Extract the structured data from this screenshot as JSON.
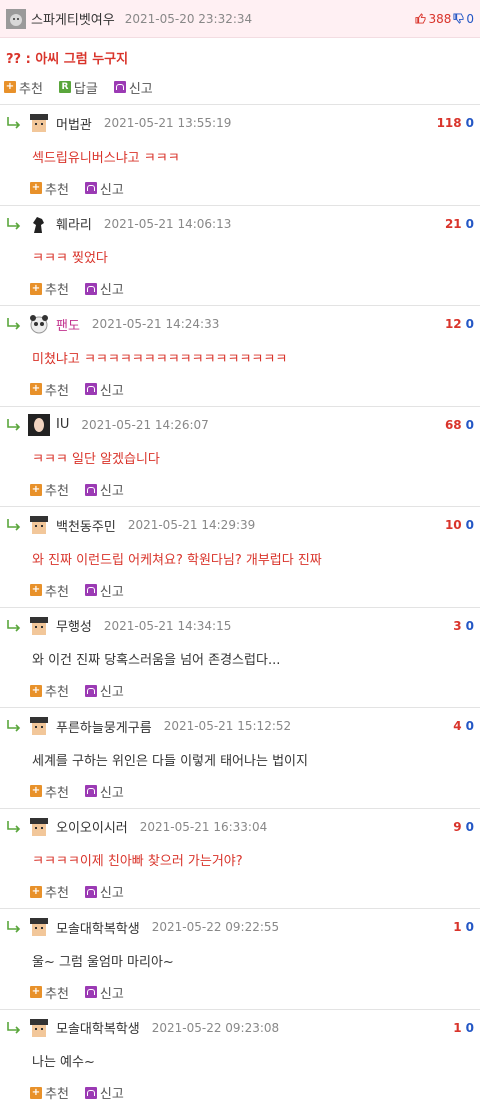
{
  "post": {
    "nick": "스파게티벳여우",
    "date": "2021-05-20 23:32:34",
    "up": "388",
    "down": "0",
    "content": "?? : 아씨 그럼 누구지",
    "recommend_label": "추천",
    "reply_label": "답글",
    "report_label": "신고"
  },
  "comments": [
    {
      "nick": "머법관",
      "date": "2021-05-21 13:55:19",
      "up": "118",
      "down": "0",
      "text": "섹드립유니버스냐고 ㅋㅋㅋ",
      "recommend": "추천",
      "report": "신고"
    },
    {
      "nick": "훼라리",
      "date": "2021-05-21 14:06:13",
      "up": "21",
      "down": "0",
      "text": "ㅋㅋㅋ 찢었다",
      "recommend": "추천",
      "report": "신고"
    },
    {
      "nick": "팬도",
      "date": "2021-05-21 14:24:33",
      "up": "12",
      "down": "0",
      "text": "미쳤냐고 ㅋㅋㅋㅋㅋㅋㅋㅋㅋㅋㅋㅋㅋㅋㅋㅋㅋ",
      "recommend": "추천",
      "report": "신고"
    },
    {
      "nick": "IU",
      "date": "2021-05-21 14:26:07",
      "up": "68",
      "down": "0",
      "text": "ㅋㅋㅋ 일단 알겠습니다",
      "recommend": "추천",
      "report": "신고"
    },
    {
      "nick": "백천동주민",
      "date": "2021-05-21 14:29:39",
      "up": "10",
      "down": "0",
      "text": "와 진짜 이런드립 어케쳐요? 학원다님? 개부럽다 진짜",
      "recommend": "추천",
      "report": "신고"
    },
    {
      "nick": "무행성",
      "date": "2021-05-21 14:34:15",
      "up": "3",
      "down": "0",
      "text": "와 이건 진짜 당혹스러움을 넘어 존경스럽다...",
      "recommend": "추천",
      "report": "신고"
    },
    {
      "nick": "푸른하늘뭉게구름",
      "date": "2021-05-21 15:12:52",
      "up": "4",
      "down": "0",
      "text": "세계를 구하는 위인은 다들 이렇게 태어나는 법이지",
      "recommend": "추천",
      "report": "신고"
    },
    {
      "nick": "오이오이시러",
      "date": "2021-05-21 16:33:04",
      "up": "9",
      "down": "0",
      "text": "ㅋㅋㅋㅋ이제 친아빠 찾으러 가는거야?",
      "recommend": "추천",
      "report": "신고"
    },
    {
      "nick": "모솔대학복학생",
      "date": "2021-05-22 09:22:55",
      "up": "1",
      "down": "0",
      "text": "울~ 그럼 울엄마 마리아~",
      "recommend": "추천",
      "report": "신고"
    },
    {
      "nick": "모솔대학복학생",
      "date": "2021-05-22 09:23:08",
      "up": "1",
      "down": "0",
      "text": "나는 예수~",
      "recommend": "추천",
      "report": "신고"
    }
  ],
  "colors": {
    "red": "#d9342b",
    "blue": "#2457c5",
    "pink_bg": "#fff0f3"
  }
}
